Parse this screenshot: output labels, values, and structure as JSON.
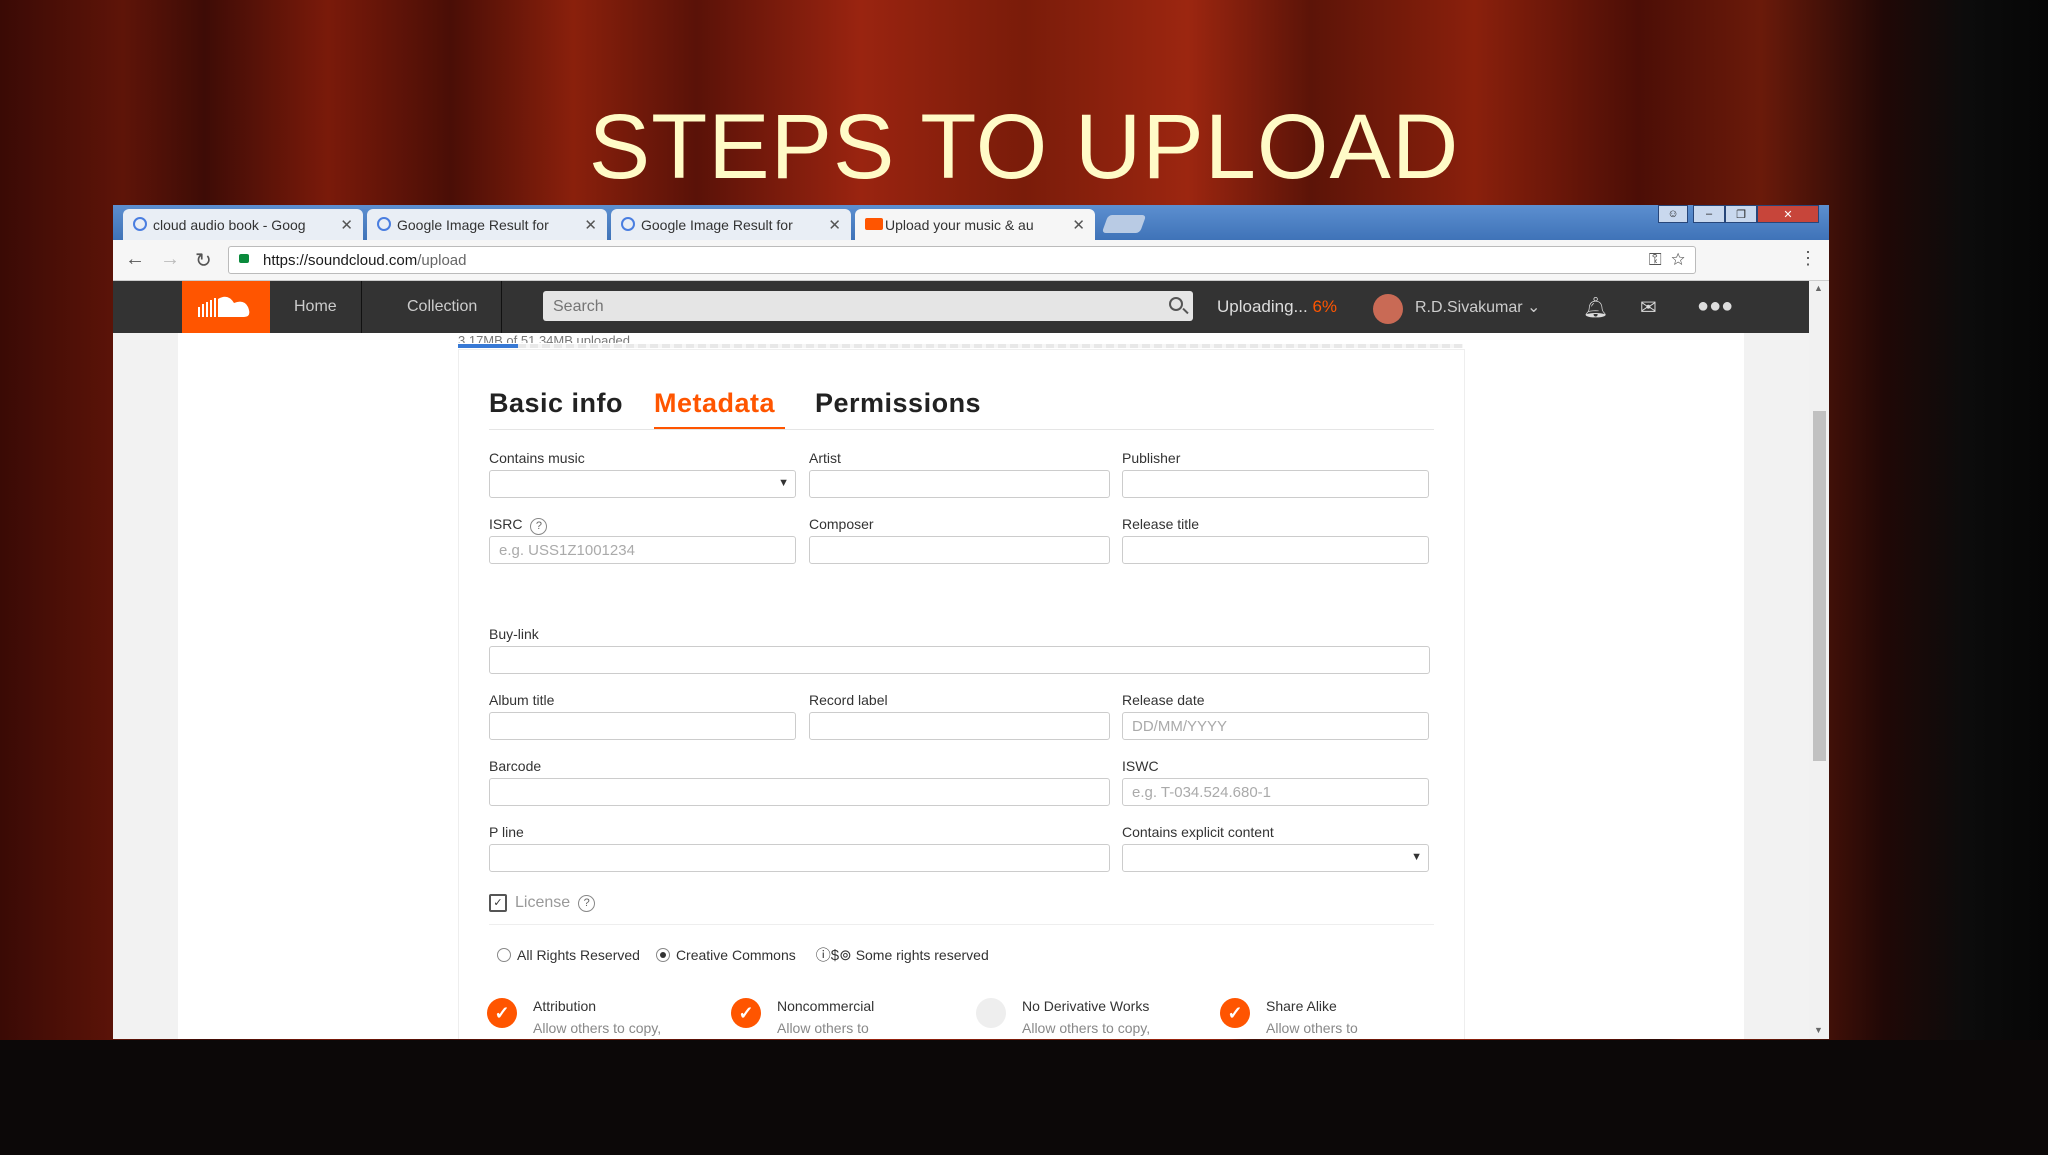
{
  "slide": {
    "title": "STEPS TO UPLOAD"
  },
  "browser": {
    "tabs": [
      {
        "label": "cloud audio book - Goog",
        "icon": "google-icon"
      },
      {
        "label": "Google Image Result for",
        "icon": "google-icon"
      },
      {
        "label": "Google Image Result for",
        "icon": "google-icon"
      },
      {
        "label": "Upload your music & au",
        "icon": "soundcloud-icon"
      }
    ],
    "close_glyph": "✕",
    "url_host": "https://soundcloud.com",
    "url_path": "/upload"
  },
  "header": {
    "nav": [
      "Home",
      "Collection"
    ],
    "search_placeholder": "Search",
    "uploading_label": "Uploading...",
    "uploading_pct": "6%",
    "user_name": "R.D.Sivakumar"
  },
  "upload": {
    "progress_text": "3.17MB of 51.34MB uploaded",
    "progress_fraction": 0.06
  },
  "form": {
    "tabs": [
      "Basic info",
      "Metadata",
      "Permissions"
    ],
    "active_tab": "Metadata",
    "labels": {
      "contains_music": "Contains music",
      "artist": "Artist",
      "publisher": "Publisher",
      "isrc": "ISRC",
      "composer": "Composer",
      "release_title": "Release title",
      "buy_link": "Buy-link",
      "album_title": "Album title",
      "record_label": "Record label",
      "release_date": "Release date",
      "barcode": "Barcode",
      "iswc": "ISWC",
      "p_line": "P line",
      "contains_explicit": "Contains explicit content"
    },
    "placeholders": {
      "isrc": "e.g. USS1Z1001234",
      "release_date": "DD/MM/YYYY",
      "iswc": "e.g. T-034.524.680-1"
    },
    "help_glyph": "?",
    "license": {
      "label": "License",
      "options": [
        "All Rights Reserved",
        "Creative Commons"
      ],
      "selected": "Creative Commons",
      "cc_note": "Some rights reserved",
      "cc_items": [
        {
          "title": "Attribution",
          "desc": "Allow others to copy,",
          "checked": true
        },
        {
          "title": "Noncommercial",
          "desc": "Allow others to",
          "checked": true
        },
        {
          "title": "No Derivative Works",
          "desc": "Allow others to copy,",
          "checked": false
        },
        {
          "title": "Share Alike",
          "desc": "Allow others to",
          "checked": true
        }
      ]
    }
  },
  "colors": {
    "accent": "#ff5500",
    "header_bg": "#333333",
    "title": "#fffbc7"
  }
}
